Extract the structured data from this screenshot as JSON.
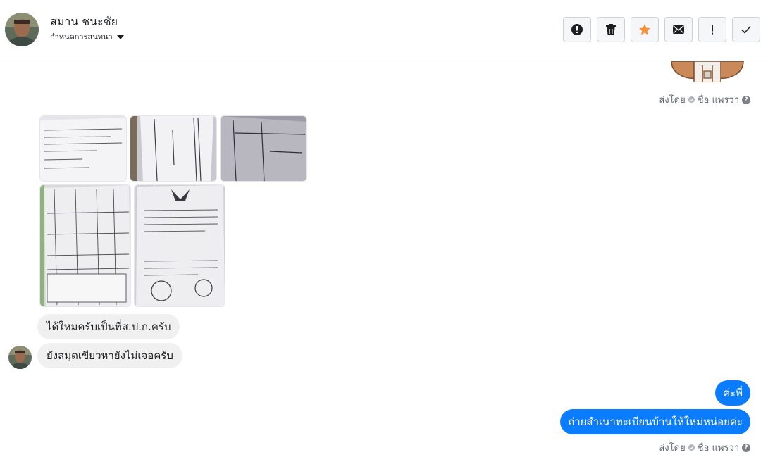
{
  "header": {
    "contact_name": "สมาน ชนะชัย",
    "settings_label": "กำหนดการสนทนา",
    "toolbar": [
      {
        "name": "report-button",
        "icon": "alert-circle-icon"
      },
      {
        "name": "delete-button",
        "icon": "trash-icon"
      },
      {
        "name": "star-button",
        "icon": "star-icon",
        "color": "#f7923b"
      },
      {
        "name": "mark-unread-button",
        "icon": "envelope-icon"
      },
      {
        "name": "mark-important-button",
        "icon": "exclamation-icon"
      },
      {
        "name": "mark-done-button",
        "icon": "check-icon"
      }
    ]
  },
  "messages": {
    "sent_by_top": {
      "label": "ส่งโดย",
      "agent": "ชื่อ แพรวา"
    },
    "photos_count": 5,
    "incoming": [
      {
        "text": "ได้ใหมครับเป็นที่ส.ป.ก.ครับ"
      },
      {
        "text": "ยังสมุดเขียวหายังไม่เจอครับ"
      }
    ],
    "outgoing": [
      {
        "text": "ค่ะพี่"
      },
      {
        "text": "ถ่ายสำเนาทะเบียนบ้านให้ใหม่หน่อยค่ะ"
      }
    ],
    "sent_by_bottom": {
      "label": "ส่งโดย",
      "agent": "ชื่อ แพรวา"
    }
  },
  "colors": {
    "outgoing_bubble": "#0a7cff",
    "incoming_bubble": "#f0f0f0",
    "star": "#f7923b"
  }
}
